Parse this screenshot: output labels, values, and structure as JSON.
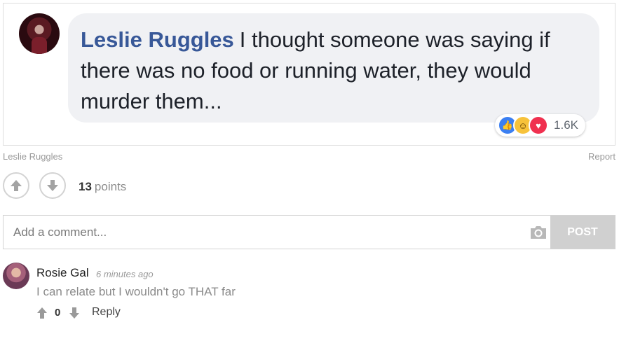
{
  "post_image": {
    "name": "Leslie Ruggles",
    "comment": "I thought someone was saying if there was no food or running water, they would murder them...",
    "reaction_icons": [
      "like-icon",
      "haha-icon",
      "love-icon"
    ],
    "reaction_count": "1.6K"
  },
  "meta": {
    "author": "Leslie Ruggles",
    "report": "Report"
  },
  "votes": {
    "points_value": "13",
    "points_label": "points"
  },
  "comment_form": {
    "placeholder": "Add a comment...",
    "post_label": "POST"
  },
  "comments": [
    {
      "author": "Rosie Gal",
      "time": "6 minutes ago",
      "text": "I can relate but I wouldn't go THAT far",
      "score": "0",
      "reply_label": "Reply"
    }
  ],
  "colors": {
    "fb_link": "#385898",
    "like": "#3b7ff2",
    "love": "#f0304f",
    "haha": "#f7c23a",
    "post_button": "#d0d0d0"
  }
}
